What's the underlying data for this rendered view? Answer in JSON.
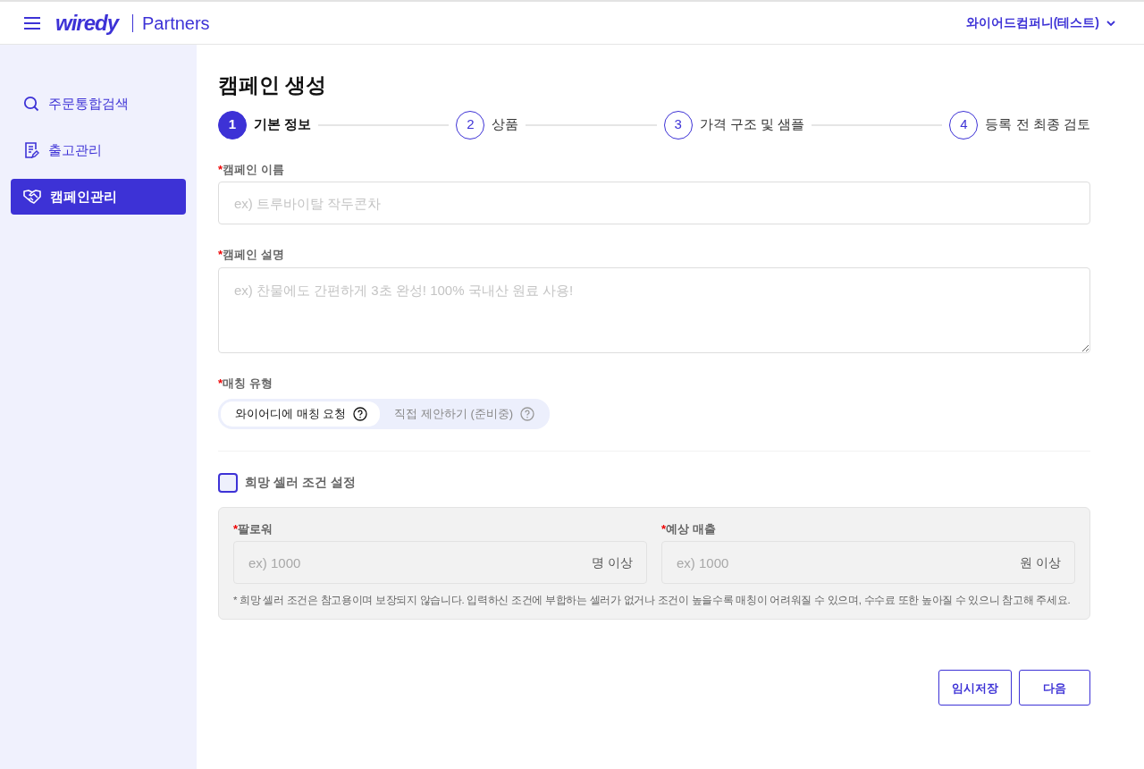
{
  "header": {
    "logo": "wiredy",
    "product": "Partners",
    "account": "와이어드컴퍼니(테스트)"
  },
  "sidebar": {
    "items": [
      {
        "label": "주문통합검색",
        "selected": false
      },
      {
        "label": "출고관리",
        "selected": false
      },
      {
        "label": "캠페인관리",
        "selected": true
      }
    ]
  },
  "page_title": "캠페인 생성",
  "steps": [
    {
      "number": "1",
      "label": "기본 정보",
      "selected": true
    },
    {
      "number": "2",
      "label": "상품",
      "selected": false
    },
    {
      "number": "3",
      "label": "가격 구조 및 샘플",
      "selected": false
    },
    {
      "number": "4",
      "label": "등록 전 최종 검토",
      "selected": false
    }
  ],
  "fields": [
    {
      "kind": "input",
      "required_mark": "*",
      "label": "캠페인 이름",
      "placeholder": "ex) 트루바이탈 작두콘차"
    },
    {
      "kind": "textarea",
      "required_mark": "*",
      "label": "캠페인 설명",
      "placeholder": "ex) 찬물에도 간편하게 3초 완성! 100% 국내산 원료 사용!"
    }
  ],
  "matching": {
    "required_mark": "*",
    "label": "매칭 유형",
    "options": [
      {
        "label": "와이어디에 매칭 요청",
        "selected": true
      },
      {
        "label": "직접 제안하기 (준비중)",
        "selected": false
      }
    ]
  },
  "seller_conditions": {
    "label": "희망 셀러 조건 설정",
    "checked": false,
    "fields": [
      {
        "required_mark": "*",
        "label": "팔로워",
        "placeholder": "ex) 1000",
        "unit": "명 이상"
      },
      {
        "required_mark": "*",
        "label": "예상 매출",
        "placeholder": "ex) 1000",
        "unit": "원 이상"
      }
    ],
    "note": "* 희망 셀러 조건은 참고용이며 보장되지 않습니다. 입력하신 조건에 부합하는 셀러가 없거나 조건이 높을수록 매칭이 어려워질 수 있으며, 수수료 또한 높아질 수 있으니 참고해 주세요."
  },
  "buttons": [
    "임시저장",
    "다음"
  ]
}
